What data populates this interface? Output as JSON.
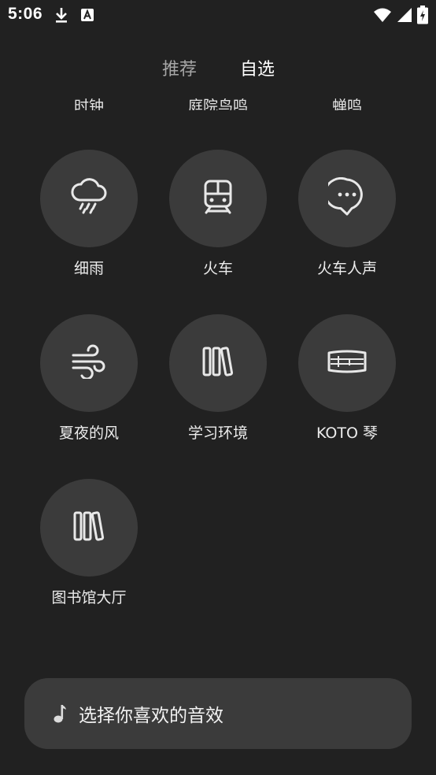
{
  "status_bar": {
    "time": "5:06",
    "icons": [
      "download-icon",
      "a-badge-icon",
      "wifi-icon",
      "signal-icon",
      "battery-charging-icon"
    ]
  },
  "tabs": [
    {
      "label": "推荐",
      "selected": false
    },
    {
      "label": "自选",
      "selected": true
    }
  ],
  "cut_off_row": [
    "时钟",
    "庭院鸟鸣",
    "蝉鸣"
  ],
  "sounds": [
    {
      "label": "细雨",
      "icon": "cloud-drizzle-icon"
    },
    {
      "label": "火车",
      "icon": "train-icon"
    },
    {
      "label": "火车人声",
      "icon": "chat-bubble-icon"
    },
    {
      "label": "夏夜的风",
      "icon": "wind-icon"
    },
    {
      "label": "学习环境",
      "icon": "books-icon"
    },
    {
      "label": "KOTO 琴",
      "icon": "koto-icon"
    },
    {
      "label": "图书馆大厅",
      "icon": "books-icon"
    }
  ],
  "bottom_bar": {
    "icon": "music-note-icon",
    "text": "选择你喜欢的音效"
  },
  "colors": {
    "background": "#212121",
    "tile": "#3b3b3b",
    "text": "#ffffff",
    "inactive_tab": "#a6a6a6"
  }
}
